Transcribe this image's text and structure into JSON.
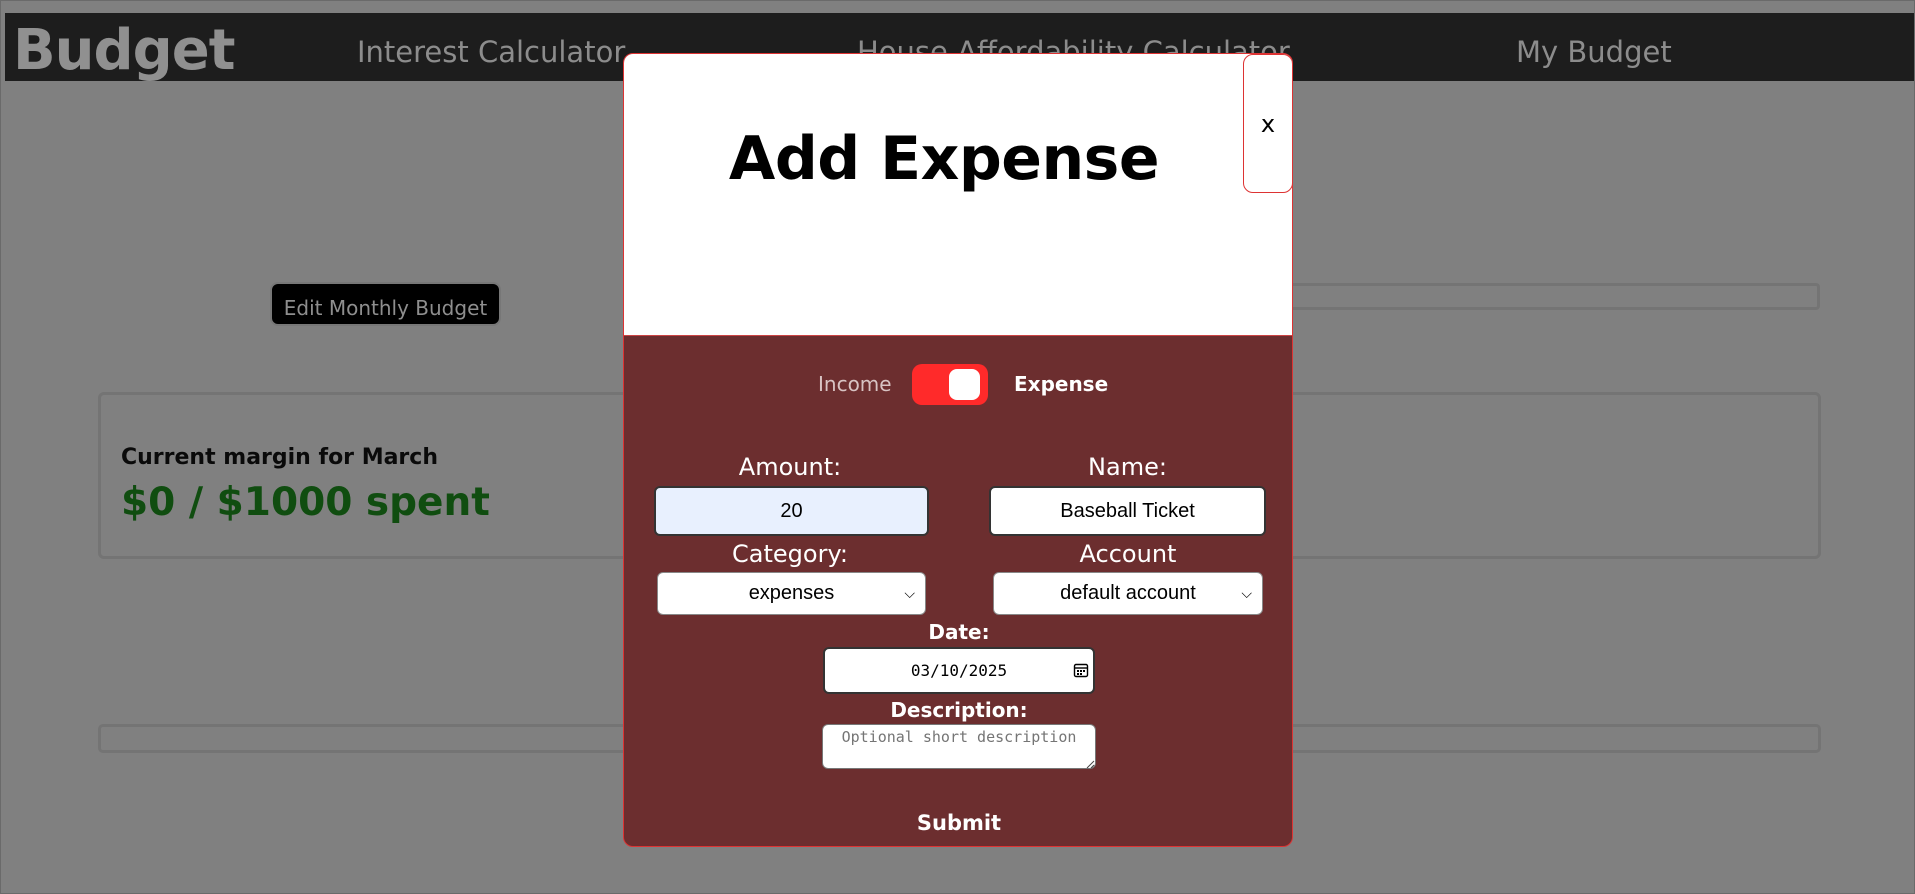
{
  "nav": {
    "brand": "Budget",
    "links": [
      "Interest Calculator",
      "House Affordability Calculator",
      "My Budget"
    ]
  },
  "background": {
    "edit_button_label": "Edit Monthly Budget",
    "margin_title": "Current margin for March",
    "margin_value": "$0 / $1000 spent"
  },
  "modal": {
    "title": "Add Expense",
    "close_label": "x",
    "toggle": {
      "left_label": "Income",
      "right_label": "Expense",
      "selected": "Expense"
    },
    "amount": {
      "label": "Amount:",
      "value": "20"
    },
    "name": {
      "label": "Name:",
      "value": "Baseball Ticket"
    },
    "category": {
      "label": "Category:",
      "selected": "expenses"
    },
    "account": {
      "label": "Account",
      "selected": "default account"
    },
    "date": {
      "label": "Date:",
      "value": "03/10/2025"
    },
    "description": {
      "label": "Description:",
      "placeholder": "Optional short description"
    },
    "submit_label": "Submit"
  },
  "colors": {
    "modal_body": "#6c2e2f",
    "toggle_on": "#ff2a2a",
    "amount_focus": "#e8f0fe",
    "margin_value": "#104d10"
  }
}
